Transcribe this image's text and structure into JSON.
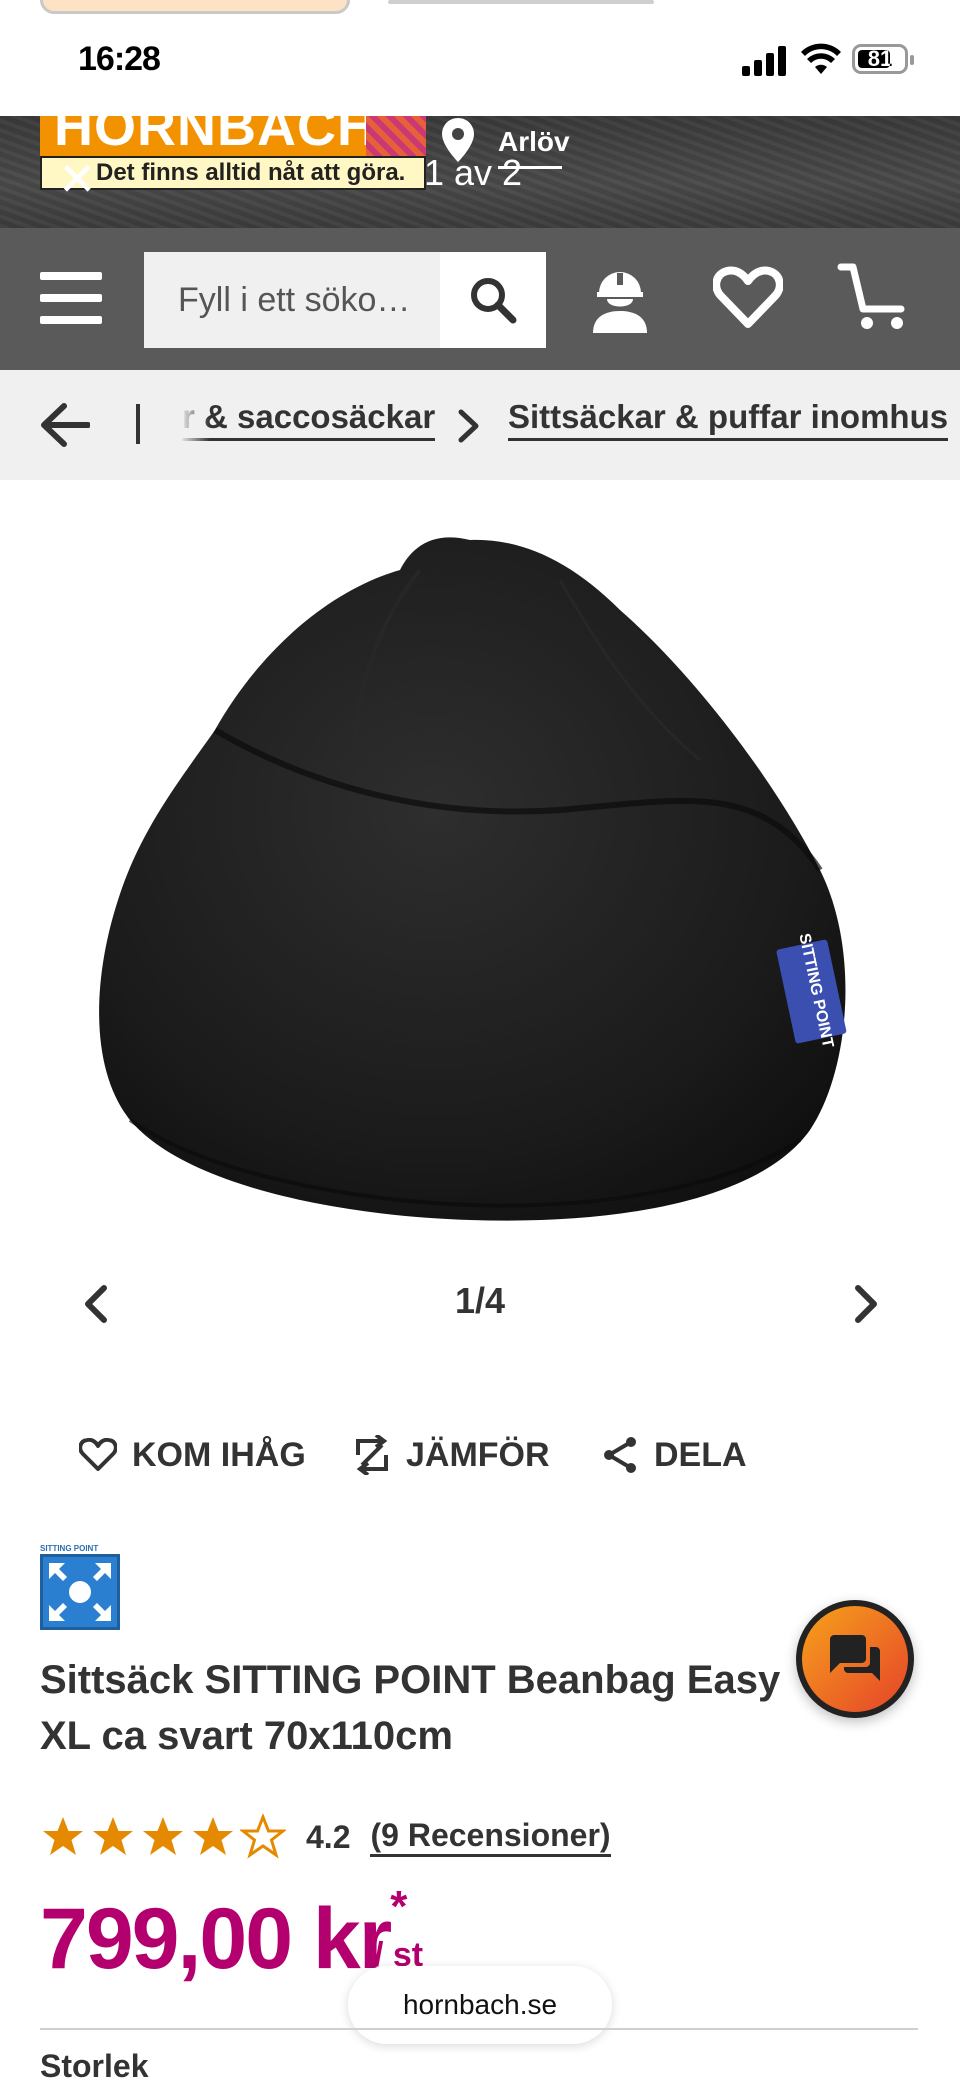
{
  "status_bar": {
    "time": "16:28",
    "battery": "81",
    "icons": [
      "signal-icon",
      "wifi-icon",
      "battery-icon"
    ]
  },
  "header": {
    "logo_text": "HORNBACH",
    "tagline": "Det finns alltid nåt att göra.",
    "location": "Arlöv",
    "overlay_counter": "1 av 2"
  },
  "nav": {
    "search_placeholder": "Fyll i ett söko…",
    "icons": [
      "menu-icon",
      "search-icon",
      "account-icon",
      "wishlist-icon",
      "cart-icon"
    ]
  },
  "breadcrumb": {
    "items": [
      "r & saccosäckar",
      "Sittsäckar & puffar inomhus"
    ]
  },
  "gallery": {
    "counter": "1/4",
    "badge_text": "SITTING POINT"
  },
  "actions": {
    "remember": "KOM IHÅG",
    "compare": "JÄMFÖR",
    "share": "DELA"
  },
  "product": {
    "brand_caption": "SITTING POINT",
    "title": "Sittsäck SITTING POINT Beanbag Easy XL ca svart 70x110cm",
    "rating": {
      "stars": 4.2,
      "value": "4.2",
      "reviews_link": "(9 Recensioner)"
    },
    "price": "799,00 kr",
    "price_asterisk": "*",
    "unit": "/ st",
    "size_label": "Storlek"
  },
  "browser": {
    "url": "hornbach.se"
  },
  "colors": {
    "brand_orange": "#f39200",
    "price_magenta": "#b4006e",
    "nav_gray": "#5a5a5a",
    "breadcrumb_bg": "#f0f0f0",
    "chat_gradient_start": "#f7a21b",
    "chat_gradient_end": "#e5432a"
  }
}
